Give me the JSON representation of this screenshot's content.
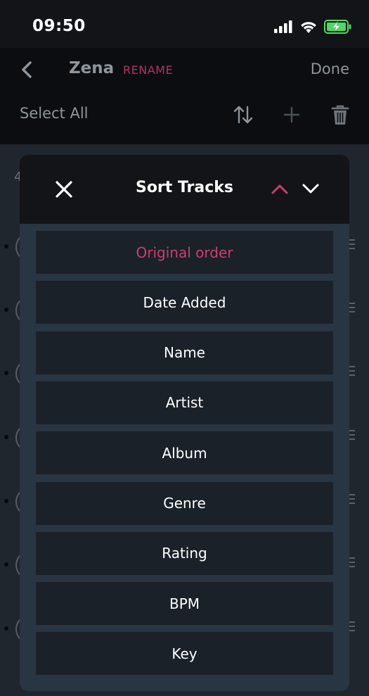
{
  "status_bar": {
    "time": "09:50"
  },
  "nav": {
    "title": "Zena",
    "rename_label": "RENAME",
    "done_label": "Done",
    "select_all_label": "Select All"
  },
  "background": {
    "count_text": "4"
  },
  "sheet": {
    "title": "Sort Tracks",
    "selected_direction": "ascending",
    "options": [
      {
        "label": "Original order",
        "selected": true
      },
      {
        "label": "Date Added",
        "selected": false
      },
      {
        "label": "Name",
        "selected": false
      },
      {
        "label": "Artist",
        "selected": false
      },
      {
        "label": "Album",
        "selected": false
      },
      {
        "label": "Genre",
        "selected": false
      },
      {
        "label": "Rating",
        "selected": false
      },
      {
        "label": "BPM",
        "selected": false
      },
      {
        "label": "Key",
        "selected": false
      }
    ]
  },
  "icons": {
    "back": "chevron-left-icon",
    "sort": "sort-arrows-icon",
    "add": "plus-icon",
    "delete": "trash-icon",
    "close": "close-icon",
    "ascending": "chevron-up-icon",
    "descending": "chevron-down-icon",
    "signal": "signal-icon",
    "wifi": "wifi-icon",
    "battery": "battery-charging-icon"
  },
  "colors": {
    "accent": "#cc3f6d",
    "rename": "#b2365e",
    "battery": "#4cd964",
    "option_bg": "#1b2129",
    "sheet_bg": "#283542"
  }
}
